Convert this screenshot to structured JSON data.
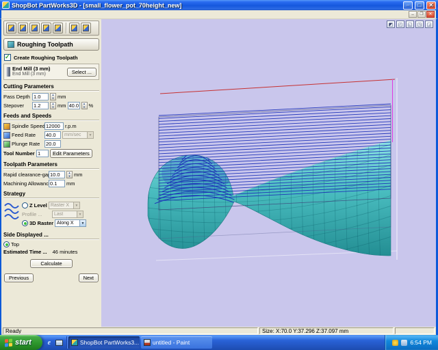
{
  "colors": {
    "viewport_bg": "#c9c6ec",
    "toolpath_blue": "#1b2fb8",
    "mesh_line": "rgba(8,92,102,0.35)",
    "pot_light": "#8ee4e4",
    "pot_mid": "#49bcbf",
    "pot_dark": "#238e93",
    "red_line": "#c63030",
    "magenta_line": "#e03ae0"
  },
  "titlebar": {
    "title": "ShopBot PartWorks3D - [small_flower_pot_70height_new]"
  },
  "sidebar": {
    "header": "Roughing Toolpath",
    "create_label": "Create Roughing Toolpath",
    "tool_name": "End Mill (3 mm)",
    "tool_sub": "End Mill (3 mm)",
    "select_button": "Select ...",
    "cutting_title": "Cutting Parameters",
    "pass_depth_label": "Pass Depth",
    "pass_depth_value": "1.0",
    "pass_depth_unit": "mm",
    "stepover_label": "Stepover",
    "stepover_value": "1.2",
    "stepover_unit": "mm",
    "stepover_pct_value": "40.0",
    "stepover_pct_unit": "%",
    "feeds_title": "Feeds and Speeds",
    "spindle_label": "Spindle Speed",
    "spindle_value": "12000",
    "spindle_unit": "r.p.m",
    "feed_label": "Feed Rate",
    "feed_value": "40.0",
    "feed_unit": "mm/sec",
    "plunge_label": "Plunge Rate",
    "plunge_value": "20.0",
    "tool_number_label": "Tool Number",
    "tool_number_value": "1",
    "edit_params_button": "Edit Parameters",
    "toolpath_title": "Toolpath Parameters",
    "rapid_label": "Rapid clearance-gap",
    "rapid_value": "10.0",
    "rapid_unit": "mm",
    "allowance_label": "Machining Allowance",
    "allowance_value": "0.1",
    "allowance_unit": "mm",
    "strategy_title": "Strategy",
    "z_level_label": "Z Level",
    "raster_combo": "Raster X",
    "profile_label": "Profile ...",
    "profile_combo": "Last",
    "raster3d_label": "3D Raster",
    "along_combo": "Along X",
    "side_title": "Side Displayed ...",
    "side_top_label": "Top",
    "est_label": "Estimated Time ...",
    "est_value": "46 minutes",
    "calculate_button": "Calculate",
    "previous_button": "Previous",
    "next_button": "Next"
  },
  "statusbar": {
    "ready": "Ready",
    "size": "Size: X:70.0 Y:37.296 Z:37.097 mm"
  },
  "taskbar": {
    "start_label": "start",
    "task1": "ShopBot PartWorks3...",
    "task2": "untitled - Paint",
    "time": "6:54 PM"
  }
}
